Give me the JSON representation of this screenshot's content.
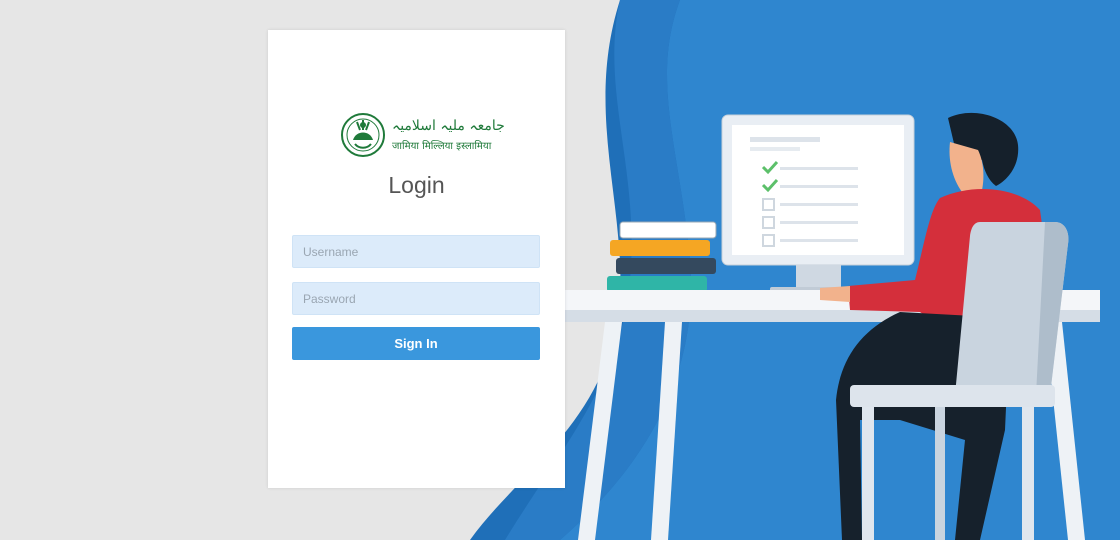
{
  "logo": {
    "urdu_name": "جامعہ ملیہ اسلامیہ",
    "hindi_name": "जामिया मिल्लिया इस्लामिया"
  },
  "login": {
    "title": "Login",
    "username_placeholder": "Username",
    "password_placeholder": "Password",
    "sign_in_label": "Sign In"
  },
  "colors": {
    "background": "#e6e6e6",
    "wave_dark": "#1f6fb8",
    "wave_light": "#2f86cf",
    "button": "#3a97dd",
    "input_fill": "#dcebfa",
    "brand_green": "#1f7a3a",
    "shirt_red": "#d42f3b"
  }
}
